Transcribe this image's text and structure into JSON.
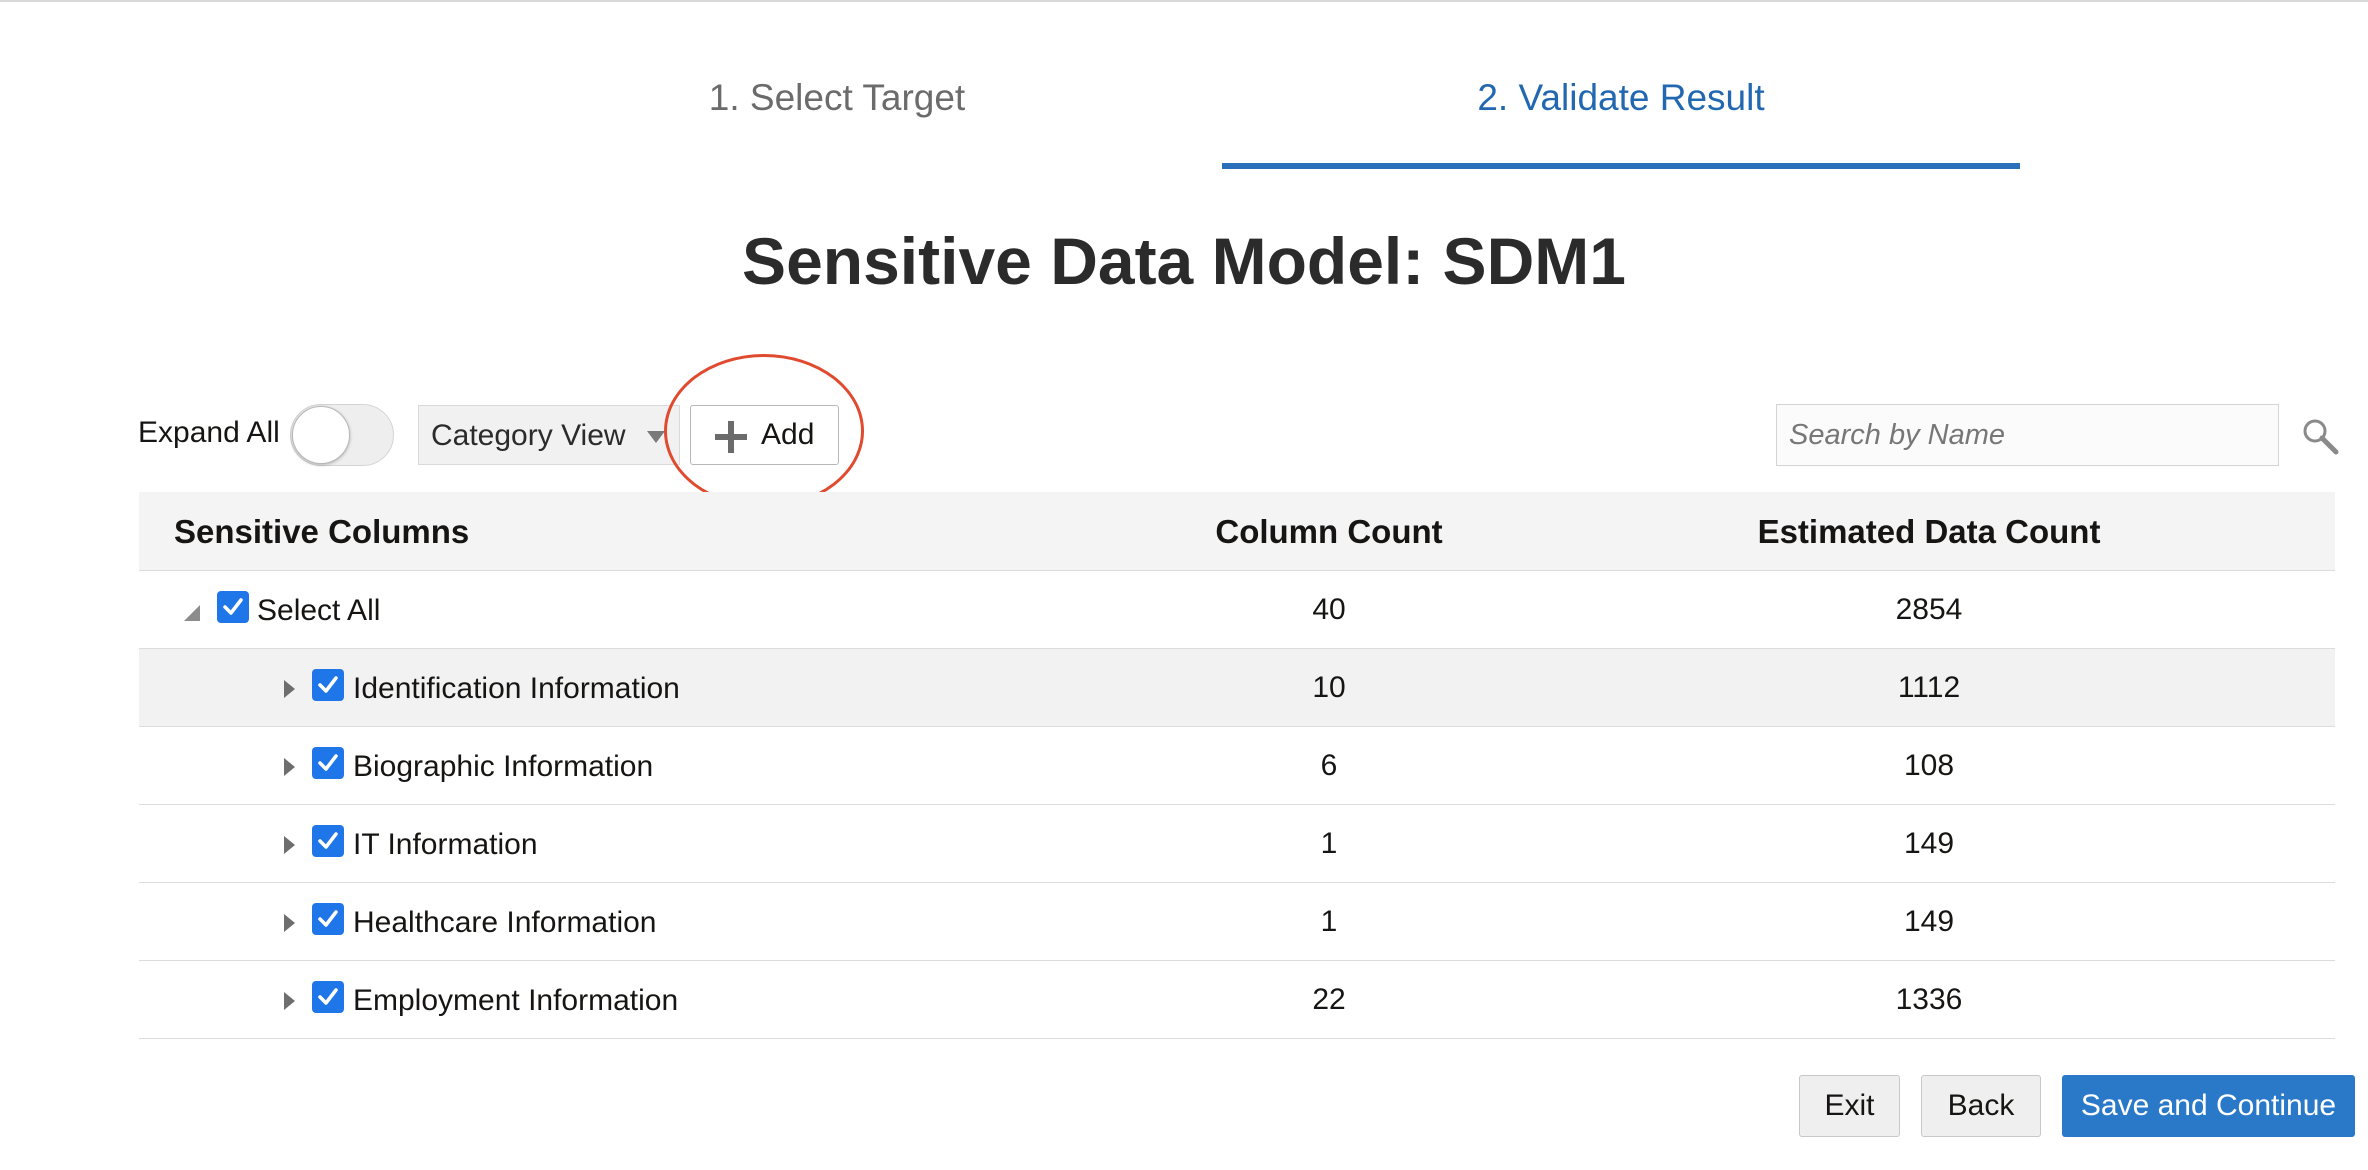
{
  "wizard": {
    "steps": [
      {
        "label": "1. Select Target"
      },
      {
        "label": "2. Validate Result"
      }
    ],
    "active_step": 2
  },
  "title": "Sensitive Data Model: SDM1",
  "toolbar": {
    "expand_all_label": "Expand All",
    "expand_all_on": false,
    "view_select_value": "Category View",
    "add_label": "Add",
    "search_placeholder": "Search by Name"
  },
  "table": {
    "headers": [
      "Sensitive Columns",
      "Column Count",
      "Estimated Data Count"
    ],
    "select_all": {
      "label": "Select All",
      "column_count": "40",
      "estimated_data_count": "2854",
      "checked": true
    },
    "rows": [
      {
        "label": "Identification Information",
        "column_count": "10",
        "estimated_data_count": "1112",
        "checked": true
      },
      {
        "label": "Biographic Information",
        "column_count": "6",
        "estimated_data_count": "108",
        "checked": true
      },
      {
        "label": "IT Information",
        "column_count": "1",
        "estimated_data_count": "149",
        "checked": true
      },
      {
        "label": "Healthcare Information",
        "column_count": "1",
        "estimated_data_count": "149",
        "checked": true
      },
      {
        "label": "Employment Information",
        "column_count": "22",
        "estimated_data_count": "1336",
        "checked": true
      }
    ]
  },
  "buttons": {
    "exit": "Exit",
    "back": "Back",
    "save_continue": "Save and Continue"
  },
  "colors": {
    "accent": "#2268b0",
    "primary_button": "#2a79c9",
    "checkbox": "#1f76e8",
    "annotation": "#e04a2e"
  }
}
